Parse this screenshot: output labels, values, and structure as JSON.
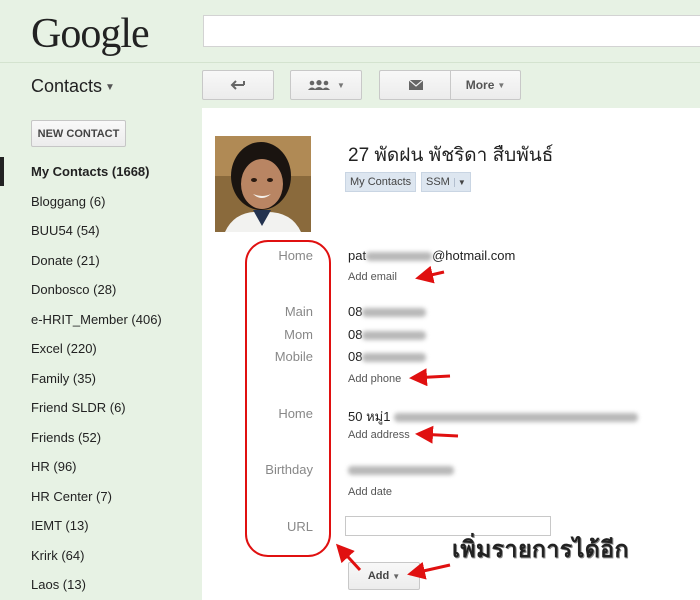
{
  "header": {
    "logo": "Google",
    "search_value": ""
  },
  "app": {
    "title": "Contacts"
  },
  "toolbar": {
    "more_label": "More"
  },
  "sidebar": {
    "new_contact_label": "NEW CONTACT",
    "items": [
      {
        "label": "My Contacts (1668)",
        "active": true
      },
      {
        "label": "Bloggang (6)"
      },
      {
        "label": "BUU54 (54)"
      },
      {
        "label": "Donate (21)"
      },
      {
        "label": "Donbosco (28)"
      },
      {
        "label": "e-HRIT_Member (406)"
      },
      {
        "label": "Excel (220)"
      },
      {
        "label": "Family (35)"
      },
      {
        "label": "Friend SLDR (6)"
      },
      {
        "label": "Friends (52)"
      },
      {
        "label": "HR (96)"
      },
      {
        "label": "HR Center (7)"
      },
      {
        "label": "IEMT (13)"
      },
      {
        "label": "Krirk (64)"
      },
      {
        "label": "Laos (13)"
      }
    ]
  },
  "contact": {
    "name": "27 พัดฝน พัชริดา สืบพันธ์",
    "groups": [
      "My Contacts",
      "SSM"
    ],
    "email": {
      "label": "Home",
      "value_prefix": "pat",
      "value_suffix": "@hotmail.com",
      "add_label": "Add email"
    },
    "phones": [
      {
        "label": "Main",
        "prefix": "08"
      },
      {
        "label": "Mom",
        "prefix": "08"
      },
      {
        "label": "Mobile",
        "prefix": "08"
      }
    ],
    "add_phone_label": "Add phone",
    "address": {
      "label": "Home",
      "prefix": "50 หมู่1",
      "add_label": "Add address"
    },
    "birthday": {
      "label": "Birthday",
      "add_label": "Add date"
    },
    "url": {
      "label": "URL",
      "value": ""
    },
    "add_button_label": "Add"
  },
  "annotation": {
    "text": "เพิ่มรายการได้อีก",
    "color": "#e01010"
  }
}
